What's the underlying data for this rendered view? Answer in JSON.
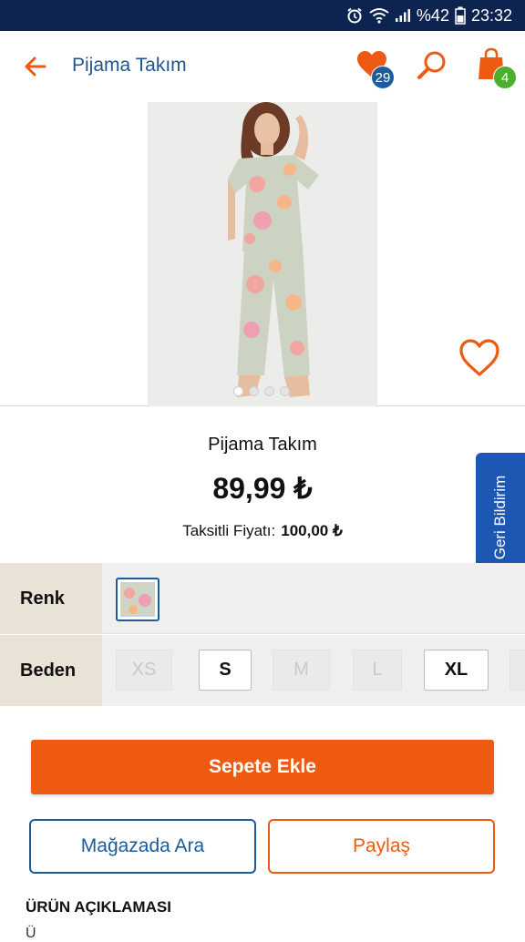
{
  "status": {
    "battery_label": "%42",
    "time": "23:32",
    "icons": [
      "alarm-icon",
      "wifi-icon",
      "signal-icon",
      "battery-icon"
    ]
  },
  "appbar": {
    "title": "Pijama Takım",
    "favorites_count": "29",
    "cart_count": "4",
    "icons": [
      "back-arrow-icon",
      "heart-icon",
      "search-icon",
      "shopping-bag-icon"
    ]
  },
  "gallery": {
    "image_count": 4,
    "active_index": 0
  },
  "product": {
    "name": "Pijama Takım",
    "price": "89,99 ₺",
    "installment_label": "Taksitli Fiyatı:",
    "installment_price": "100,00 ₺"
  },
  "feedback": {
    "label": "Geri Bildirim"
  },
  "options": {
    "color_label": "Renk",
    "size_label": "Beden",
    "sizes": [
      {
        "label": "XS",
        "available": false
      },
      {
        "label": "S",
        "available": true
      },
      {
        "label": "M",
        "available": false
      },
      {
        "label": "L",
        "available": false
      },
      {
        "label": "XL",
        "available": true
      }
    ]
  },
  "actions": {
    "add_to_cart": "Sepete Ekle",
    "search_in_store": "Mağazada Ara",
    "share": "Paylaş"
  },
  "description": {
    "title": "ÜRÜN AÇIKLAMASI",
    "peek": "Ü"
  },
  "colors": {
    "status_bar": "#0d2451",
    "brand_orange": "#ee5a12",
    "brand_blue": "#1d5b9a",
    "badge_green": "#4caf30",
    "feedback_blue": "#1d57b4"
  }
}
